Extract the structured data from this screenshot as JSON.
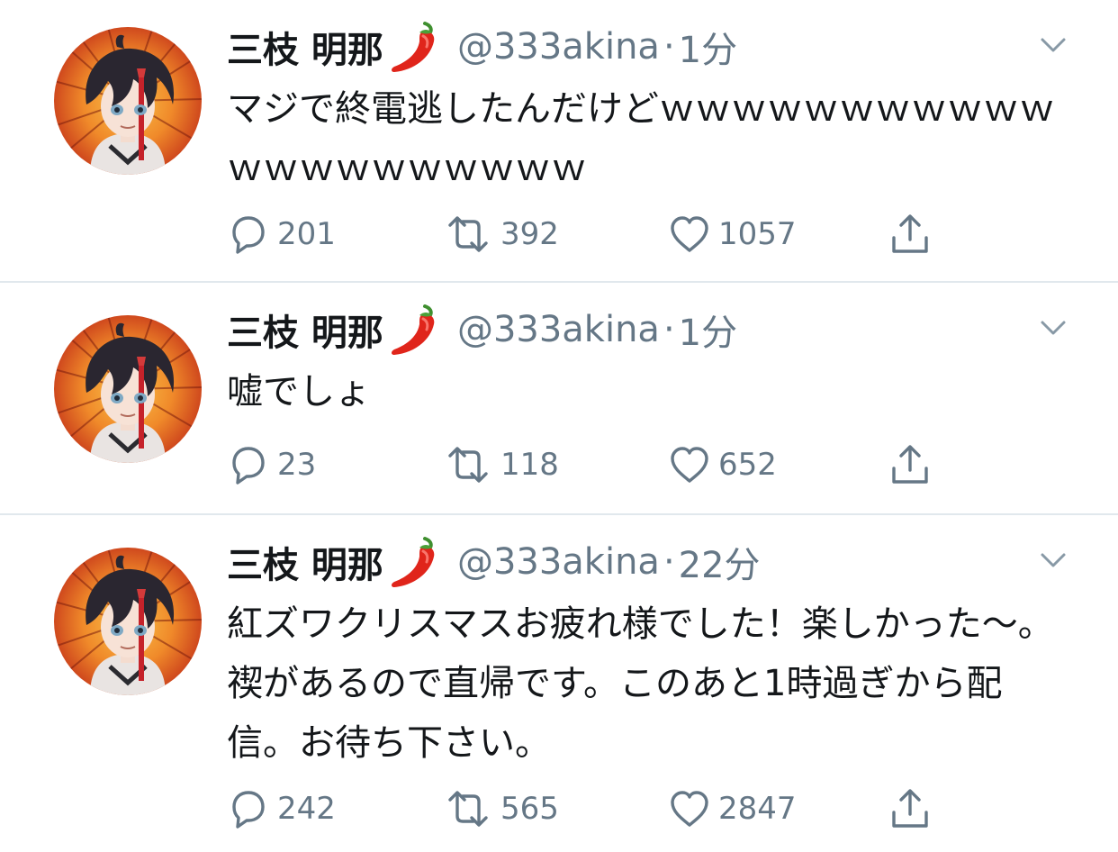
{
  "colors": {
    "text": "#14171a",
    "secondary": "#657786",
    "divider": "#e1e8ed",
    "background": "#ffffff"
  },
  "tweets": [
    {
      "name": "三枝 明那",
      "name_emoji": "hot-pepper",
      "handle": "@333akina",
      "separator": "·",
      "time": "1分",
      "text": "マジで終電逃したんだけどｗｗｗｗｗｗｗｗｗｗｗｗｗｗｗｗｗｗｗｗｗ",
      "replies": "201",
      "retweets": "392",
      "likes": "1057"
    },
    {
      "name": "三枝 明那",
      "name_emoji": "hot-pepper",
      "handle": "@333akina",
      "separator": "·",
      "time": "1分",
      "text": "嘘でしょ",
      "replies": "23",
      "retweets": "118",
      "likes": "652"
    },
    {
      "name": "三枝 明那",
      "name_emoji": "hot-pepper",
      "handle": "@333akina",
      "separator": "·",
      "time": "22分",
      "text": "紅ズワクリスマスお疲れ様でした！楽しかった〜。禊があるので直帰です。このあと1時過ぎから配信。お待ち下さい。",
      "replies": "242",
      "retweets": "565",
      "likes": "2847"
    }
  ],
  "icons": {
    "reply": "reply-icon",
    "retweet": "retweet-icon",
    "like": "heart-icon",
    "share": "share-icon",
    "caret": "chevron-down-icon",
    "avatar": "avatar"
  }
}
